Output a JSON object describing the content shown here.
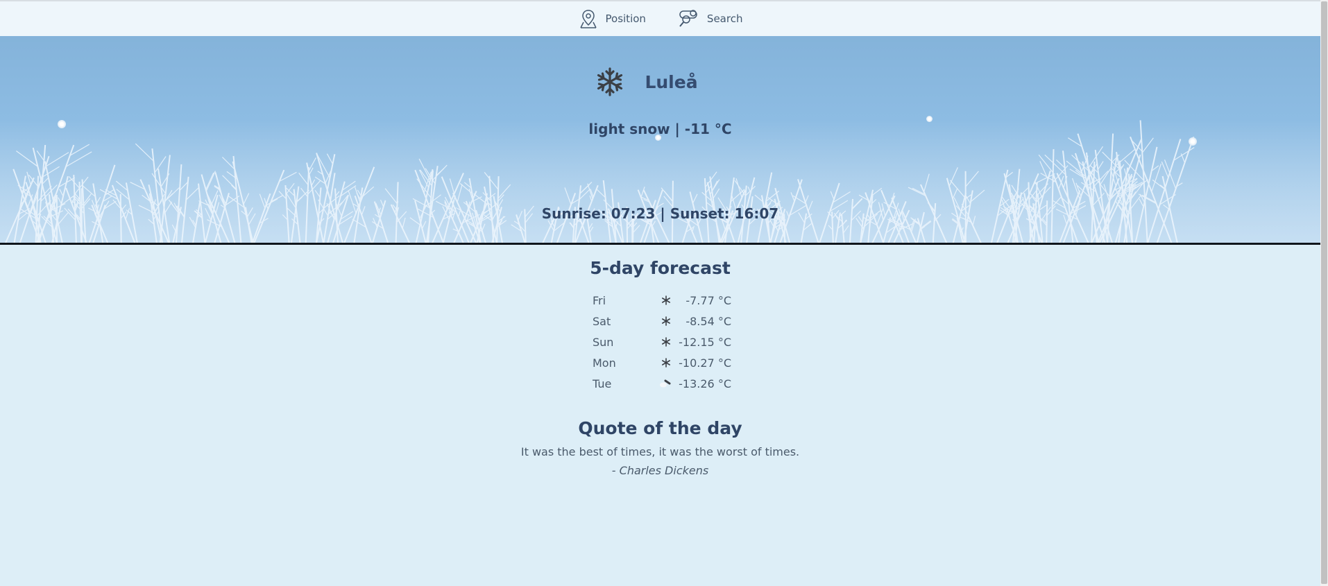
{
  "nav": {
    "position_label": "Position",
    "search_label": "Search"
  },
  "current": {
    "city": "Luleå",
    "condition_line": "light snow | -11 °C",
    "sun_line": "Sunrise: 07:23 |  Sunset: 16:07",
    "icon": "snowflake-icon"
  },
  "forecast": {
    "title": "5-day forecast",
    "days": [
      {
        "day": "Fri",
        "icon": "snowflake-icon",
        "temp": "-7.77 °C"
      },
      {
        "day": "Sat",
        "icon": "snowflake-icon",
        "temp": "-8.54 °C"
      },
      {
        "day": "Sun",
        "icon": "snowflake-icon",
        "temp": "-12.15 °C"
      },
      {
        "day": "Mon",
        "icon": "snowflake-icon",
        "temp": "-10.27 °C"
      },
      {
        "day": "Tue",
        "icon": "cloud-night-icon",
        "temp": "-13.26 °C"
      }
    ]
  },
  "quote": {
    "title": "Quote of the day",
    "text": "It was the best of times, it was the worst of times.",
    "author": "- Charles Dickens"
  },
  "colors": {
    "page_bg": "#ddeef7",
    "hero_sky": "#8dbce3",
    "heading": "#2f4566"
  }
}
